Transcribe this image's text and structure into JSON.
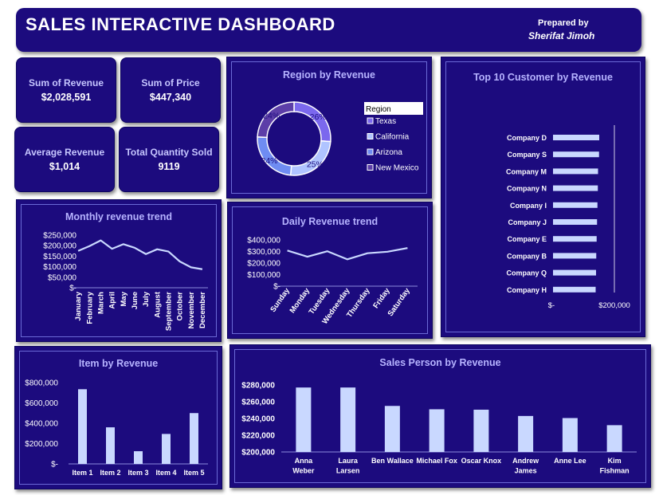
{
  "header": {
    "title": "SALES INTERACTIVE  DASHBOARD",
    "prepared_label": "Prepared by",
    "author": "Sherifat Jimoh"
  },
  "kpis": [
    {
      "label": "Sum of Revenue",
      "value": "$2,028,591"
    },
    {
      "label": "Sum of Price",
      "value": "$447,340"
    },
    {
      "label": "Average Revenue",
      "value": "$1,014"
    },
    {
      "label": "Total Quantity Sold",
      "value": "9119"
    }
  ],
  "colors": {
    "panel_bg": "#1c0b7e",
    "bar": "#c9d8ff",
    "line": "#c9d8ff",
    "title_text": "#b6b3ff",
    "donut": [
      "#7b68ee",
      "#b0c4ff",
      "#6f8cf2",
      "#5c3ea8"
    ]
  },
  "chart_data": [
    {
      "id": "region",
      "type": "pie",
      "title": "Region by Revenue",
      "legend_title": "Region",
      "legend_position": "right",
      "categories": [
        "Texas",
        "California",
        "Arizona",
        "New Mexico"
      ],
      "values": [
        26,
        25,
        24,
        24
      ],
      "labels": [
        "26%",
        "25%",
        "24%",
        "24%"
      ]
    },
    {
      "id": "top_customers",
      "type": "bar",
      "orientation": "horizontal",
      "title": "Top 10 Customer by Revenue",
      "categories": [
        "Company D",
        "Company S",
        "Company M",
        "Company N",
        "Company I",
        "Company J",
        "Company E",
        "Company B",
        "Company Q",
        "Company H"
      ],
      "values": [
        116000,
        115500,
        113000,
        112500,
        111500,
        110500,
        109500,
        108500,
        108000,
        107000
      ],
      "xlim": [
        0,
        240000
      ],
      "x_tick_labels": [
        "$-",
        "$200,000"
      ],
      "grid": false
    },
    {
      "id": "monthly",
      "type": "line",
      "title": "Monthly revenue trend",
      "categories": [
        "January",
        "February",
        "March",
        "April",
        "May",
        "June",
        "July",
        "August",
        "September",
        "October",
        "November",
        "December"
      ],
      "values": [
        175000,
        198000,
        225000,
        185000,
        207000,
        190000,
        160000,
        183000,
        172000,
        125000,
        97000,
        88000
      ],
      "ylim": [
        0,
        250000
      ],
      "y_tick_labels": [
        "$-",
        "$50,000",
        "$100,000",
        "$150,000",
        "$200,000",
        "$250,000"
      ],
      "grid": false
    },
    {
      "id": "daily",
      "type": "line",
      "title": "Daily Revenue trend",
      "categories": [
        "Sunday",
        "Monday",
        "Tuesday",
        "Wednesday",
        "Thursday",
        "Friday",
        "Saturday"
      ],
      "values": [
        308000,
        255000,
        302000,
        232000,
        285000,
        298000,
        330000
      ],
      "ylim": [
        0,
        400000
      ],
      "y_tick_labels": [
        "$-",
        "$100,000",
        "$200,000",
        "$300,000",
        "$400,000"
      ],
      "grid": false
    },
    {
      "id": "items",
      "type": "bar",
      "title": "Item by Revenue",
      "categories": [
        "Item 1",
        "Item 2",
        "Item 3",
        "Item 4",
        "Item 5"
      ],
      "values": [
        735000,
        360000,
        125000,
        295000,
        500000
      ],
      "ylim": [
        0,
        800000
      ],
      "y_tick_labels": [
        "$-",
        "$200,000",
        "$400,000",
        "$600,000",
        "$800,000"
      ],
      "grid": false
    },
    {
      "id": "salesperson",
      "type": "bar",
      "title": "Sales Person by Revenue",
      "categories": [
        "Anna Weber",
        "Laura Larsen",
        "Ben Wallace",
        "Michael Fox",
        "Oscar Knox",
        "Andrew James",
        "Anne Lee",
        "Kim Fishman"
      ],
      "values": [
        277000,
        277000,
        255000,
        251000,
        250500,
        243000,
        240500,
        232000
      ],
      "ylim": [
        200000,
        280000
      ],
      "y_tick_labels": [
        "$200,000",
        "$220,000",
        "$240,000",
        "$260,000",
        "$280,000"
      ],
      "grid": false
    }
  ]
}
